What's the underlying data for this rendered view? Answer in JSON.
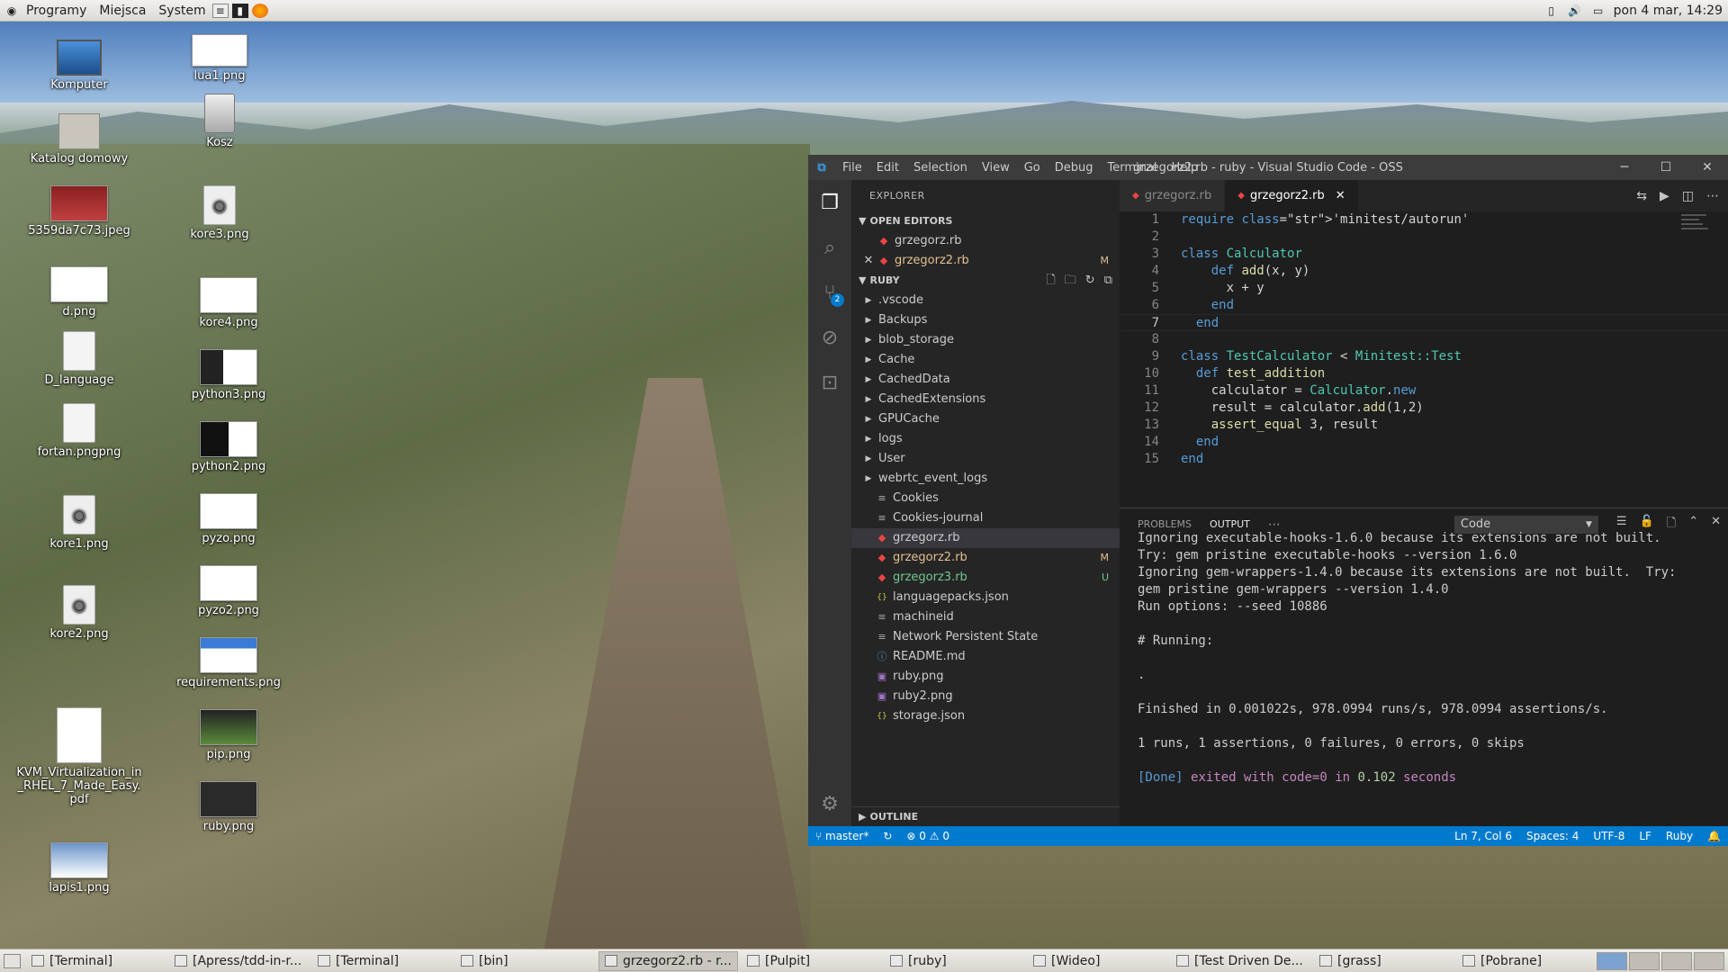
{
  "top_panel": {
    "menus": [
      "Programy",
      "Miejsca",
      "System"
    ],
    "clock": "pon  4 mar, 14:29"
  },
  "desktop_icons": [
    {
      "label": "Komputer",
      "icon": "computer-icon"
    },
    {
      "label": "lua1.png",
      "icon": "image-thumbnail"
    },
    {
      "label": "Katalog domowy",
      "icon": "home-folder-icon"
    },
    {
      "label": "Kosz",
      "icon": "trash-icon"
    },
    {
      "label": "5359da7c73.jpeg",
      "icon": "image-thumbnail"
    },
    {
      "label": "kore3.png",
      "icon": "audio-file-icon"
    },
    {
      "label": "d.png",
      "icon": "image-thumbnail"
    },
    {
      "label": "kore4.png",
      "icon": "image-thumbnail"
    },
    {
      "label": "D_language",
      "icon": "text-file-icon"
    },
    {
      "label": "python3.png",
      "icon": "image-thumbnail"
    },
    {
      "label": "fortan.pngpng",
      "icon": "text-file-icon"
    },
    {
      "label": "python2.png",
      "icon": "image-thumbnail"
    },
    {
      "label": "kore1.png",
      "icon": "audio-file-icon"
    },
    {
      "label": "pyzo.png",
      "icon": "image-thumbnail"
    },
    {
      "label": "kore2.png",
      "icon": "audio-file-icon"
    },
    {
      "label": "pyzo2.png",
      "icon": "image-thumbnail"
    },
    {
      "label": "requirements.png",
      "icon": "image-thumbnail"
    },
    {
      "label": "KVM_Virtualization_in_RHEL_7_Made_Easy.pdf",
      "icon": "pdf-file-icon"
    },
    {
      "label": "pip.png",
      "icon": "image-thumbnail"
    },
    {
      "label": "ruby.png",
      "icon": "image-thumbnail"
    },
    {
      "label": "lapis1.png",
      "icon": "image-thumbnail"
    }
  ],
  "vscode": {
    "menu": [
      "File",
      "Edit",
      "Selection",
      "View",
      "Go",
      "Debug",
      "Terminal",
      "Help"
    ],
    "title": "grzegorz2.rb - ruby - Visual Studio Code - OSS",
    "explorer_title": "EXPLORER",
    "open_editors_header": "OPEN EDITORS",
    "open_editors": [
      {
        "name": "grzegorz.rb",
        "status": ""
      },
      {
        "name": "grzegorz2.rb",
        "status": "M"
      }
    ],
    "folder_header": "RUBY",
    "tree": [
      {
        "name": ".vscode",
        "type": "folder"
      },
      {
        "name": "Backups",
        "type": "folder"
      },
      {
        "name": "blob_storage",
        "type": "folder"
      },
      {
        "name": "Cache",
        "type": "folder"
      },
      {
        "name": "CachedData",
        "type": "folder"
      },
      {
        "name": "CachedExtensions",
        "type": "folder"
      },
      {
        "name": "GPUCache",
        "type": "folder"
      },
      {
        "name": "logs",
        "type": "folder"
      },
      {
        "name": "User",
        "type": "folder"
      },
      {
        "name": "webrtc_event_logs",
        "type": "folder"
      },
      {
        "name": "Cookies",
        "type": "file"
      },
      {
        "name": "Cookies-journal",
        "type": "file"
      },
      {
        "name": "grzegorz.rb",
        "type": "ruby",
        "status": ""
      },
      {
        "name": "grzegorz2.rb",
        "type": "ruby",
        "status": "M"
      },
      {
        "name": "grzegorz3.rb",
        "type": "ruby",
        "status": "U"
      },
      {
        "name": "languagepacks.json",
        "type": "json"
      },
      {
        "name": "machineid",
        "type": "file"
      },
      {
        "name": "Network Persistent State",
        "type": "file"
      },
      {
        "name": "README.md",
        "type": "md"
      },
      {
        "name": "ruby.png",
        "type": "image"
      },
      {
        "name": "ruby2.png",
        "type": "image"
      },
      {
        "name": "storage.json",
        "type": "json"
      }
    ],
    "outline_header": "OUTLINE",
    "tabs": [
      {
        "label": "grzegorz.rb",
        "active": false
      },
      {
        "label": "grzegorz2.rb",
        "active": true
      }
    ],
    "scm_badge": "2",
    "code_lines": [
      "require 'minitest/autorun'",
      "",
      "class Calculator",
      "    def add(x, y)",
      "      x + y",
      "    end",
      "  end",
      "",
      "class TestCalculator < Minitest::Test",
      "  def test_addition",
      "    calculator = Calculator.new",
      "    result = calculator.add(1,2)",
      "    assert_equal 3, result",
      "  end",
      "end"
    ],
    "panel_tabs": [
      "PROBLEMS",
      "OUTPUT"
    ],
    "panel_select": "Code",
    "output_lines": [
      "Ignoring executable-hooks-1.6.0 because its extensions are not built.",
      "Try: gem pristine executable-hooks --version 1.6.0",
      "Ignoring gem-wrappers-1.4.0 because its extensions are not built.  Try:",
      "gem pristine gem-wrappers --version 1.4.0",
      "Run options: --seed 10886",
      "",
      "# Running:",
      "",
      ".",
      "",
      "Finished in 0.001022s, 978.0994 runs/s, 978.0994 assertions/s.",
      "",
      "1 runs, 1 assertions, 0 failures, 0 errors, 0 skips",
      ""
    ],
    "output_done": "[Done]",
    "output_exited": "exited with",
    "output_code": "code=0",
    "output_in": "in",
    "output_secs": "0.102",
    "output_seconds": "seconds",
    "status": {
      "branch": "master*",
      "errors": "0",
      "warnings": "0",
      "position": "Ln 7, Col 6",
      "spaces": "Spaces: 4",
      "encoding": "UTF-8",
      "eol": "LF",
      "language": "Ruby"
    }
  },
  "taskbar": [
    {
      "label": "[Terminal]",
      "active": false
    },
    {
      "label": "[Apress/tdd-in-r...",
      "active": false
    },
    {
      "label": "[Terminal]",
      "active": false
    },
    {
      "label": "[bin]",
      "active": false
    },
    {
      "label": "grzegorz2.rb - r...",
      "active": true
    },
    {
      "label": "[Pulpit]",
      "active": false
    },
    {
      "label": "[ruby]",
      "active": false
    },
    {
      "label": "[Wideo]",
      "active": false
    },
    {
      "label": "[Test Driven De...",
      "active": false
    },
    {
      "label": "[grass]",
      "active": false
    },
    {
      "label": "[Pobrane]",
      "active": false
    }
  ]
}
